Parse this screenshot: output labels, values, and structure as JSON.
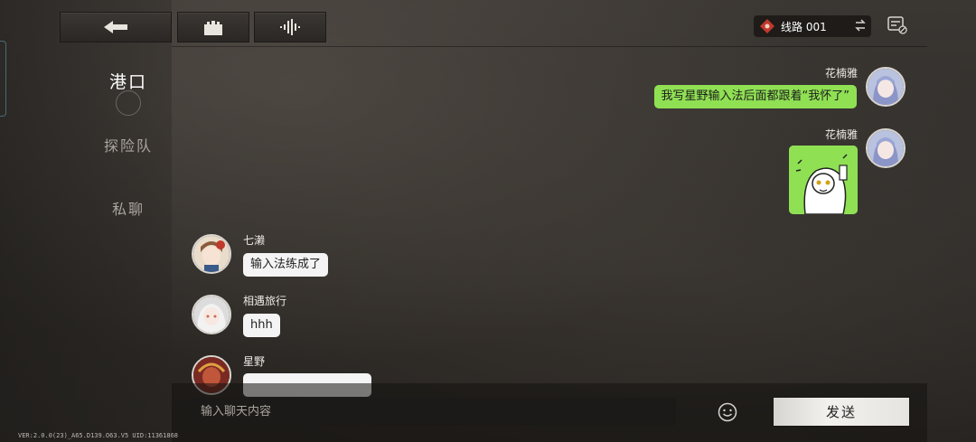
{
  "colors": {
    "bubble_self": "#8fe053",
    "bubble_other": "#f4f4f4",
    "send_button": "#eceae6",
    "route_badge": "#c0392b"
  },
  "top_buttons": [
    {
      "icon": "back-arrow-icon"
    },
    {
      "icon": "castle-icon"
    },
    {
      "icon": "sound-wave-icon"
    }
  ],
  "route": {
    "label": "线路 001",
    "icon": "route-gem-icon",
    "swap_icon": "swap-icon"
  },
  "filter_icon": "message-filter-icon",
  "nav": {
    "items": [
      {
        "label": "港口",
        "active": true
      },
      {
        "label": "探险队",
        "active": false
      },
      {
        "label": "私聊",
        "active": false
      }
    ]
  },
  "messages": [
    {
      "sender": "花楠雅",
      "side": "right",
      "type": "text",
      "text": "我写星野输入法后面都跟着“我怀了”"
    },
    {
      "sender": "花楠雅",
      "side": "right",
      "type": "sticker"
    },
    {
      "sender": "七濑",
      "side": "left",
      "type": "text",
      "text": "输入法练成了"
    },
    {
      "sender": "相遇旅行",
      "side": "left",
      "type": "text",
      "text": "hhh"
    },
    {
      "sender": "星野",
      "side": "left",
      "type": "text",
      "text": ""
    }
  ],
  "input": {
    "placeholder": "输入聊天内容",
    "value": ""
  },
  "emoji_icon": "smiley-icon",
  "send_label": "发送",
  "version_text": "VER:2.0.0(23)_A65.D139.O63.V5   UID:11361868"
}
